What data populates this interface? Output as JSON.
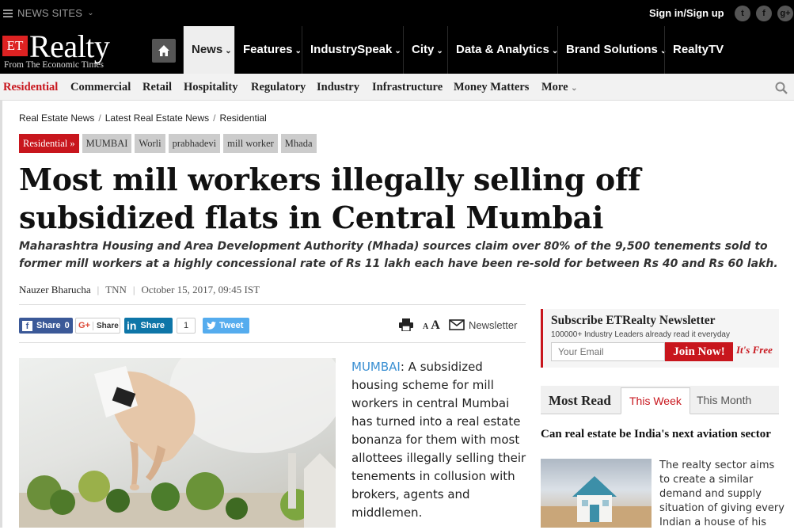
{
  "topbar": {
    "sites_label": "NEWS SITES",
    "signin_label": "Sign in/Sign up",
    "social": [
      "twitter-icon",
      "facebook-icon",
      "google-plus-icon"
    ]
  },
  "logo": {
    "et": "ET",
    "name": "Realty",
    "tagline": "From The Economic Times"
  },
  "main_nav": [
    {
      "label": "News",
      "caret": true,
      "active": true
    },
    {
      "label": "Features",
      "caret": true
    },
    {
      "label": "IndustrySpeak",
      "caret": true
    },
    {
      "label": "City",
      "caret": true
    },
    {
      "label": "Data & Analytics",
      "caret": true
    },
    {
      "label": "Brand Solutions",
      "caret": true
    },
    {
      "label": "RealtyTV",
      "caret": false
    }
  ],
  "sub_nav": [
    "Residential",
    "Commercial",
    "Retail",
    "Hospitality",
    "Regulatory",
    "Industry",
    "Infrastructure",
    "Money Matters",
    "More"
  ],
  "breadcrumb": [
    "Real Estate News",
    "Latest Real Estate News",
    "Residential"
  ],
  "tags": [
    "Residential »",
    "MUMBAI",
    "Worli",
    "prabhadevi",
    "mill worker",
    "Mhada"
  ],
  "article": {
    "headline": "Most mill workers illegally selling off subsidized flats in Central Mumbai",
    "summary": "Maharashtra Housing and Area Development Authority (Mhada) sources claim over 80% of the 9,500 tenements sold to former mill workers at a highly concessional rate of Rs 11 lakh each have been re-sold for between Rs 40 and Rs 60 lakh.",
    "author": "Nauzer Bharucha",
    "source": "TNN",
    "date": "October 15, 2017, 09:45 IST",
    "location": "MUMBAI",
    "body": ": A subsidized housing scheme for mill workers in central Mumbai has turned into a real estate bonanza for them with most allottees illegally selling their tenements in collusion with brokers, agents and middlemen."
  },
  "share": {
    "fb_label": "Share",
    "fb_count": "0",
    "gp_label": "Share",
    "li_label": "Share",
    "li_count": "1",
    "tw_label": "Tweet",
    "newsletter_label": "Newsletter",
    "font_small": "A",
    "font_large": "A"
  },
  "newsletter_box": {
    "title": "Subscribe ETRealty Newsletter",
    "subtitle": "100000+ Industry Leaders already read it everyday",
    "placeholder": "Your Email",
    "button": "Join Now!",
    "free": "It's Free"
  },
  "most_read": {
    "title": "Most Read",
    "tabs": [
      "This Week",
      "This Month"
    ],
    "headline": "Can real estate be India's next aviation sector",
    "desc": "The realty sector aims to create a similar demand and supply situation of giving every Indian a house of his"
  },
  "colors": {
    "brand_red": "#c8161d",
    "link_blue": "#3a8fd2",
    "nav_black": "#000000"
  }
}
